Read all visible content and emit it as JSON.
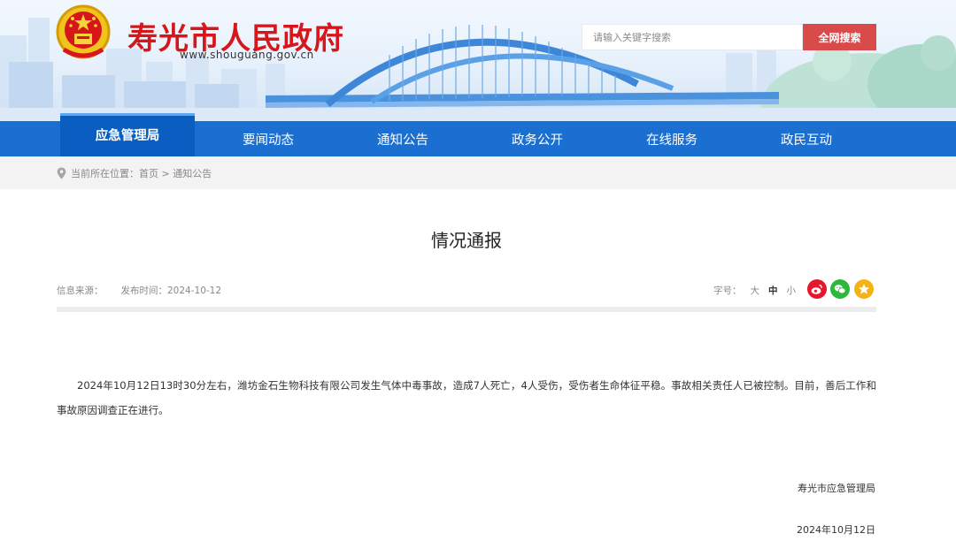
{
  "header": {
    "site_title": "寿光市人民政府",
    "site_url": "www.shouguang.gov.cn",
    "search_placeholder": "请输入关键字搜索",
    "search_button": "全网搜索",
    "brand_red": "#d6161b"
  },
  "nav": {
    "items": [
      {
        "label": "应急管理局",
        "active": true
      },
      {
        "label": "要闻动态"
      },
      {
        "label": "通知公告"
      },
      {
        "label": "政务公开"
      },
      {
        "label": "在线服务"
      },
      {
        "label": "政民互动"
      }
    ],
    "color": "#1a6fd0"
  },
  "breadcrumb": {
    "prefix": "当前所在位置：",
    "home": "首页",
    "separator": " > ",
    "current": "通知公告"
  },
  "article": {
    "title": "情况通报",
    "source_label": "信息来源：",
    "date_label": "发布时间：",
    "date": "2024-10-12",
    "font_label": "字号：",
    "font_large": "大",
    "font_medium": "中",
    "font_small": "小",
    "share_icons": [
      "weibo-icon",
      "wechat-icon",
      "favorite-icon"
    ],
    "body": "2024年10月12日13时30分左右，潍坊金石生物科技有限公司发生气体中毒事故，造成7人死亡，4人受伤，受伤者生命体征平稳。事故相关责任人已被控制。目前，善后工作和事故原因调查正在进行。",
    "signature": "寿光市应急管理局",
    "signature_date": "2024年10月12日"
  }
}
